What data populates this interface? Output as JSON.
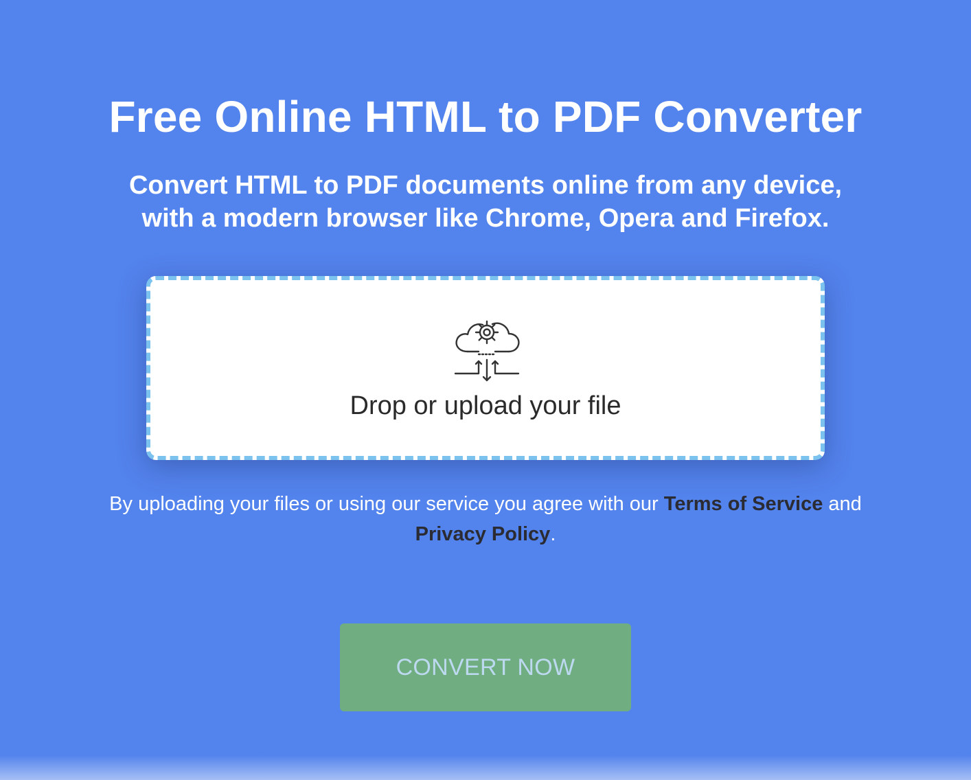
{
  "hero": {
    "title": "Free Online HTML to PDF Converter",
    "subtitle_line1": "Convert HTML to PDF documents online from any device,",
    "subtitle_line2": "with a modern browser like Chrome, Opera and Firefox."
  },
  "dropzone": {
    "icon": "cloud-gear-upload-icon",
    "label": "Drop or upload your file"
  },
  "terms": {
    "prefix": "By uploading your files or using our service you agree with our ",
    "tos_link": "Terms of Service",
    "middle": " and ",
    "privacy_link": "Privacy Policy",
    "suffix": "."
  },
  "action": {
    "convert_label": "CONVERT NOW"
  },
  "colors": {
    "background": "#5383ec",
    "dropzone_border": "#7cc2ee",
    "button_bg": "#70ad80",
    "button_text": "#bcd9f0",
    "link_text": "#2b2b33"
  }
}
